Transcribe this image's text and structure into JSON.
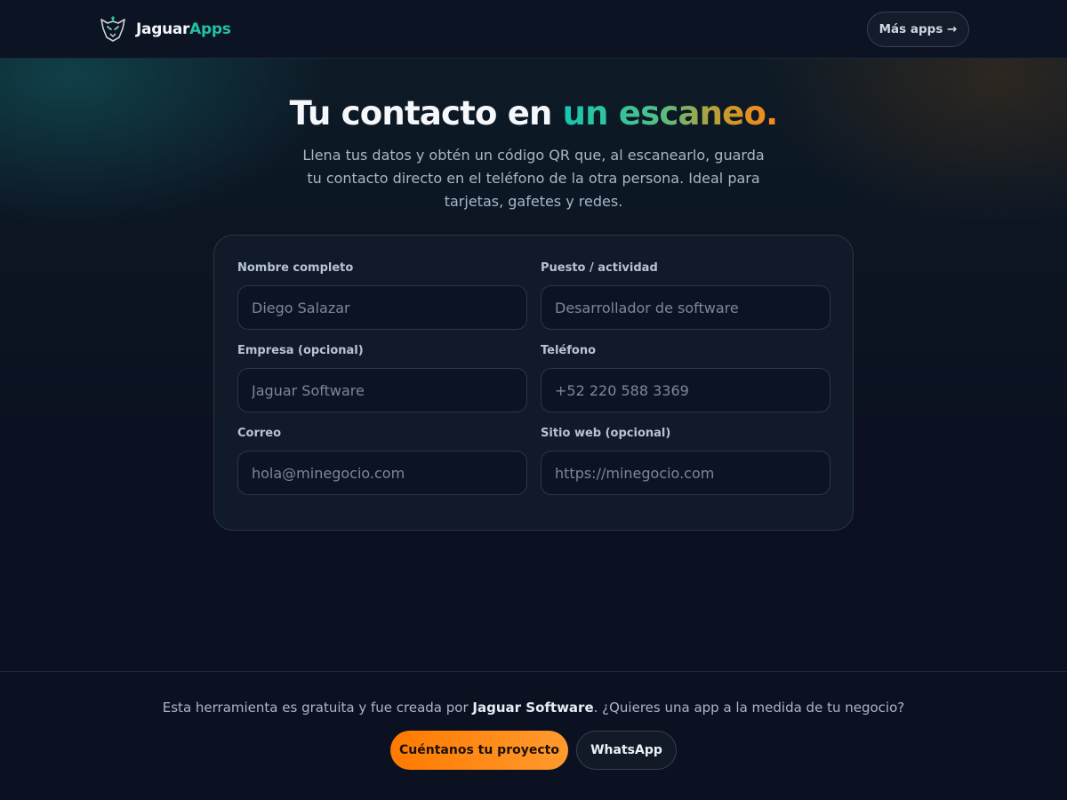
{
  "header": {
    "brand_part1": "Jaguar",
    "brand_part2": "Apps",
    "logo_icon": "jaguar-head-icon",
    "more_apps_label": "Más apps →"
  },
  "hero": {
    "title_part1": "Tu contacto en ",
    "title_highlight": "un escaneo",
    "title_dot": ".",
    "subtitle": "Llena tus datos y obtén un código QR que, al escanearlo, guarda tu contacto directo en el teléfono de la otra persona. Ideal para tarjetas, gafetes y redes."
  },
  "form": {
    "fields": [
      {
        "label": "Nombre completo",
        "placeholder": "Diego Salazar",
        "value": ""
      },
      {
        "label": "Puesto / actividad",
        "placeholder": "Desarrollador de software",
        "value": ""
      },
      {
        "label": "Empresa (opcional)",
        "placeholder": "Jaguar Software",
        "value": ""
      },
      {
        "label": "Teléfono",
        "placeholder": "+52 220 588 3369",
        "value": ""
      },
      {
        "label": "Correo",
        "placeholder": "hola@minegocio.com",
        "value": ""
      },
      {
        "label": "Sitio web (opcional)",
        "placeholder": "https://minegocio.com",
        "value": ""
      }
    ]
  },
  "footer": {
    "text_before": "Esta herramienta es gratuita y fue creada por ",
    "text_brand": "Jaguar Software",
    "text_after": ". ¿Quieres una app a la medida de tu negocio?",
    "cta_label": "Cuéntanos tu proyecto",
    "whatsapp_label": "WhatsApp"
  },
  "colors": {
    "accent_teal": "#22c1a6",
    "accent_orange": "#ff7a00",
    "background": "#0b1120"
  }
}
